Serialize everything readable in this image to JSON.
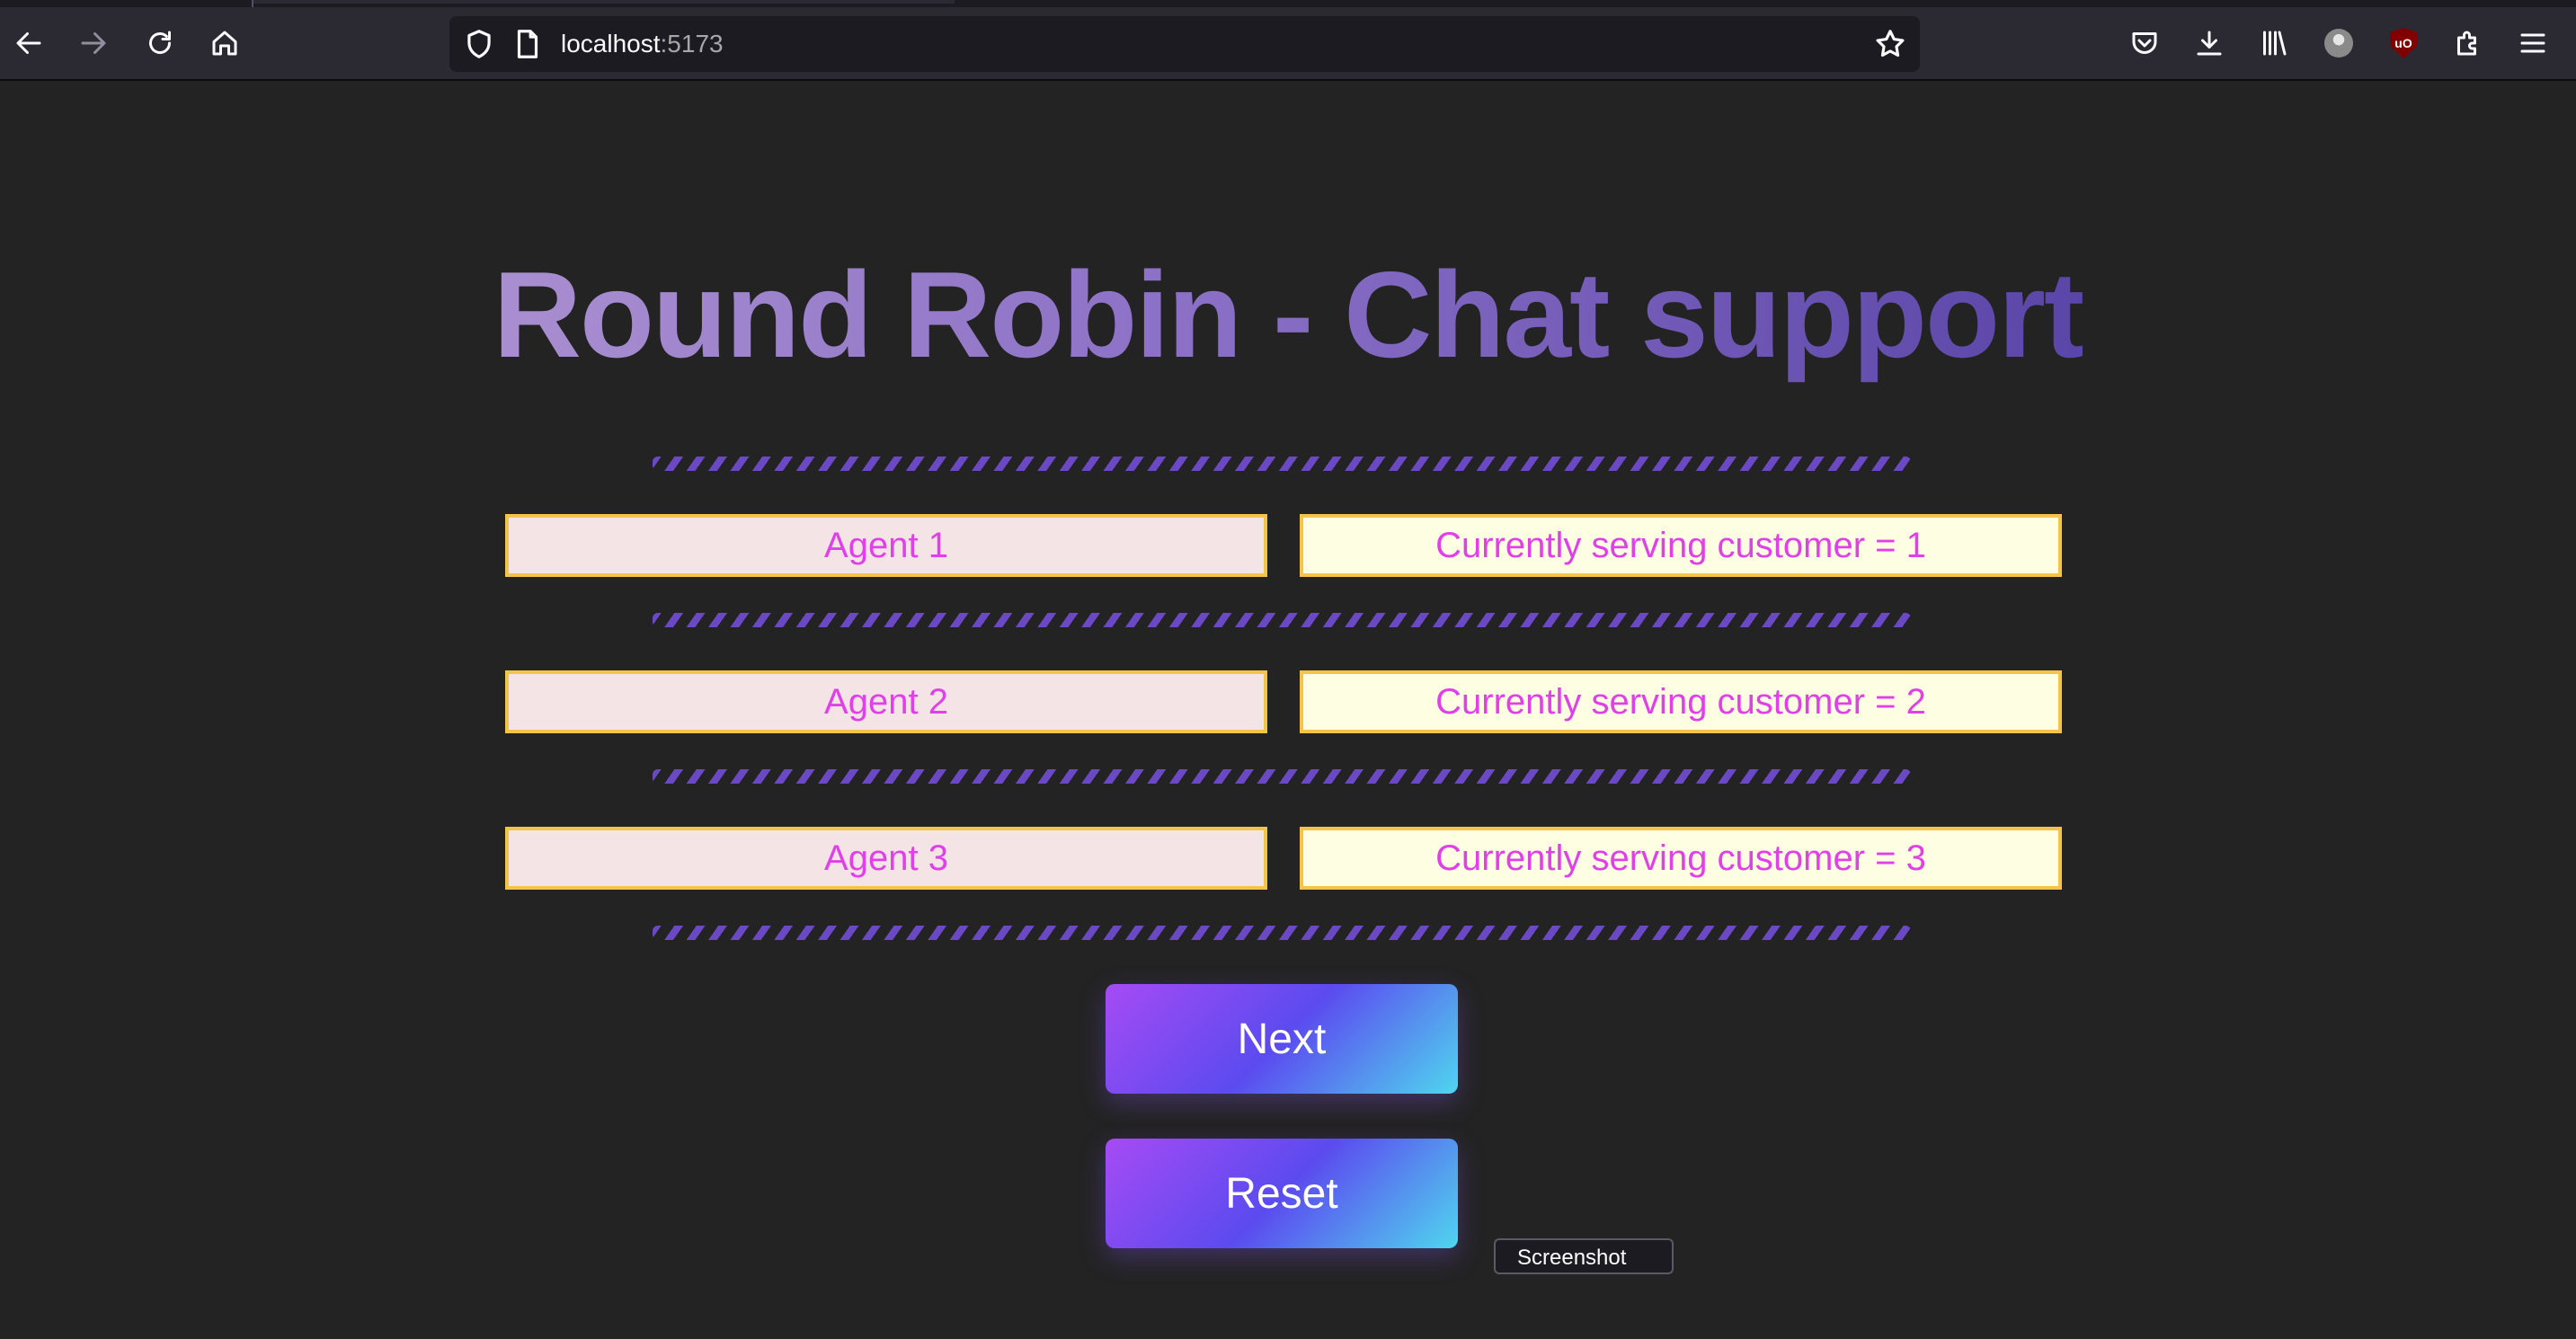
{
  "browser": {
    "url_host": "localhost",
    "url_port": ":5173"
  },
  "page": {
    "title": "Round Robin - Chat support",
    "rows": [
      {
        "agent": "Agent 1",
        "serving": "Currently serving customer = 1"
      },
      {
        "agent": "Agent 2",
        "serving": "Currently serving customer = 2"
      },
      {
        "agent": "Agent 3",
        "serving": "Currently serving customer = 3"
      }
    ],
    "next_label": "Next",
    "reset_label": "Reset"
  },
  "tooltip": {
    "text": "Screenshot"
  },
  "colors": {
    "background": "#232323",
    "title_gradient_start": "#a98fd0",
    "title_gradient_end": "#5a46a8",
    "divider": "#6b48c4",
    "cell_border": "#f4c34a",
    "cell_text": "#e040e8",
    "agent_cell_bg": "#f4e4e6",
    "serving_cell_bg": "#fefee2",
    "button_gradient": [
      "#a64bf4",
      "#5b4bef",
      "#4fd6ee"
    ]
  }
}
